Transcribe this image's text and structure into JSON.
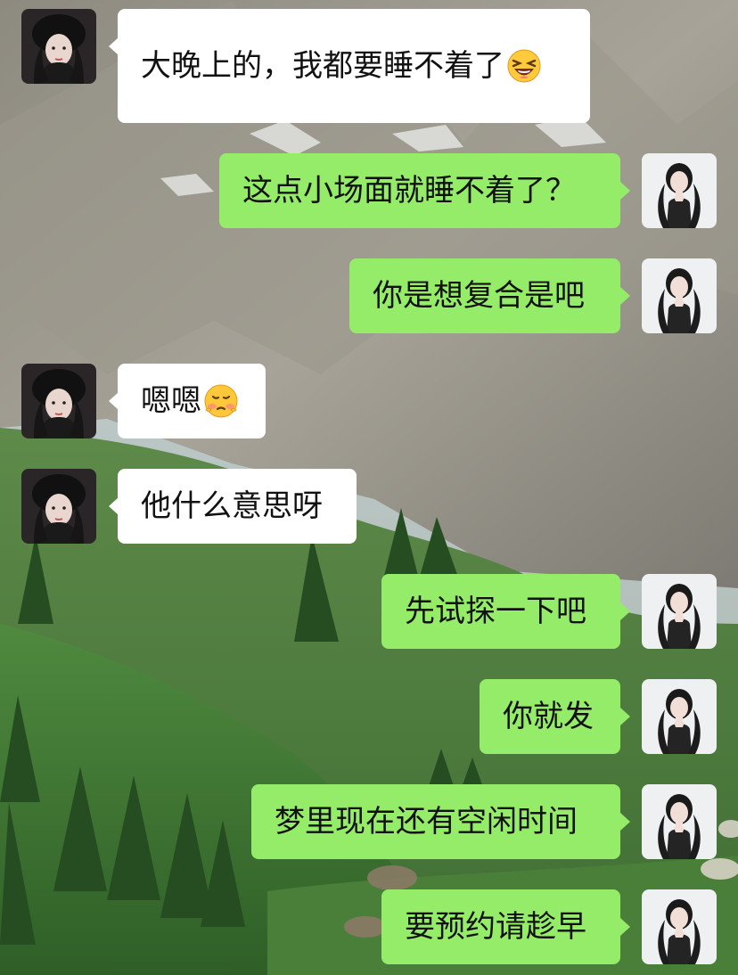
{
  "messages": [
    {
      "side": "left",
      "text": "大晚上的，我都要睡不着了",
      "emoji": "laughing-squint-emoji"
    },
    {
      "side": "right",
      "text": "这点小场面就睡不着了？"
    },
    {
      "side": "right",
      "text": "你是想复合是吧"
    },
    {
      "side": "left",
      "text": "嗯嗯",
      "emoji": "pouting-emoji"
    },
    {
      "side": "left",
      "text": "他什么意思呀"
    },
    {
      "side": "right",
      "text": "先试探一下吧"
    },
    {
      "side": "right",
      "text": "你就发"
    },
    {
      "side": "right",
      "text": "梦里现在还有空闲时间"
    },
    {
      "side": "right",
      "text": "要预约请趁早"
    }
  ],
  "colors": {
    "sent_bubble": "#95ec69",
    "received_bubble": "#ffffff",
    "text": "#111111"
  }
}
